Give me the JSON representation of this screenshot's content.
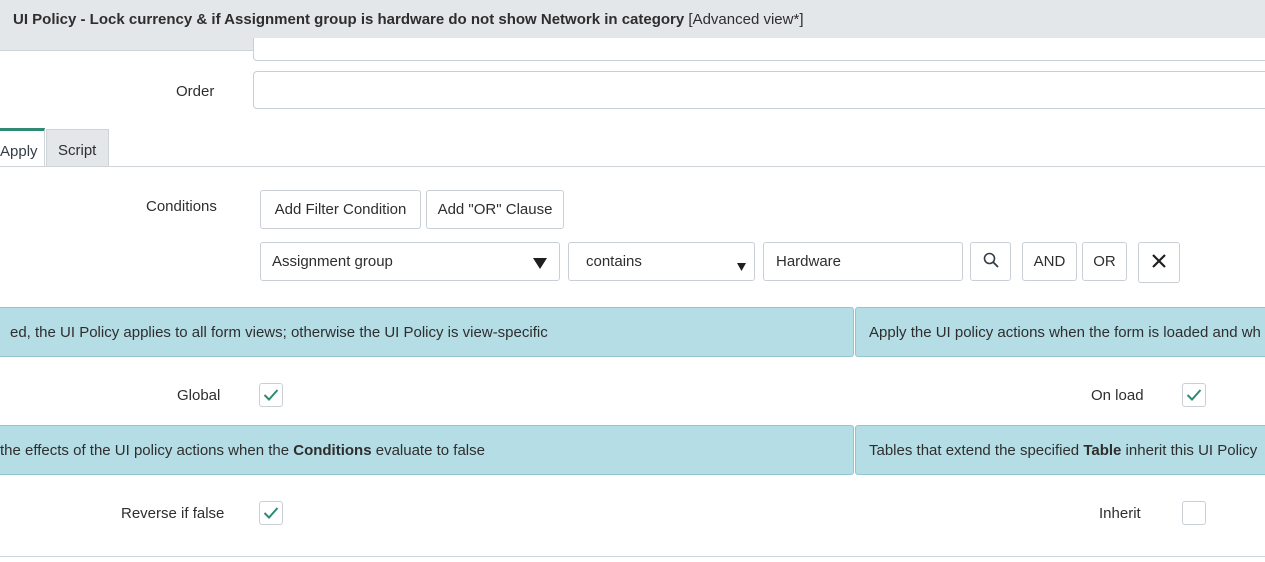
{
  "header": {
    "title": "UI Policy - Lock currency & if Assignment group is hardware do not show Network in category",
    "view": "[Advanced view*]"
  },
  "fields": {
    "order_label": "Order",
    "order_value": "",
    "conditions_label": "Conditions",
    "global_label": "Global",
    "global_checked": true,
    "onload_label": "On load",
    "onload_checked": true,
    "reverse_label": "Reverse if false",
    "reverse_checked": true,
    "inherit_label": "Inherit",
    "inherit_checked": false
  },
  "tabs": [
    {
      "label": "Apply",
      "active": true
    },
    {
      "label": "Script",
      "active": false
    }
  ],
  "condition_builder": {
    "add_filter_label": "Add Filter Condition",
    "add_or_label": "Add \"OR\" Clause",
    "field": "Assignment group",
    "operator": "contains",
    "value": "Hardware",
    "and_label": "AND",
    "or_label": "OR"
  },
  "help": {
    "global": "ed, the UI Policy applies to all form views; otherwise the UI Policy is view-specific",
    "onload": "Apply the UI policy actions when the form is loaded and wh",
    "reverse_pre": " the effects of the UI policy actions when the ",
    "reverse_bold": "Conditions",
    "reverse_post": " evaluate to false",
    "inherit_pre": "Tables that extend the specified ",
    "inherit_bold": "Table",
    "inherit_post": " inherit this UI Policy"
  },
  "colors": {
    "help_bg": "#b5dde5",
    "check_color": "#2e8a72",
    "active_tab_border": "#2e8a72"
  },
  "icons": {
    "search": "search-icon",
    "remove": "close-icon",
    "dropdown": "chevron-down-icon",
    "check": "check-icon"
  }
}
